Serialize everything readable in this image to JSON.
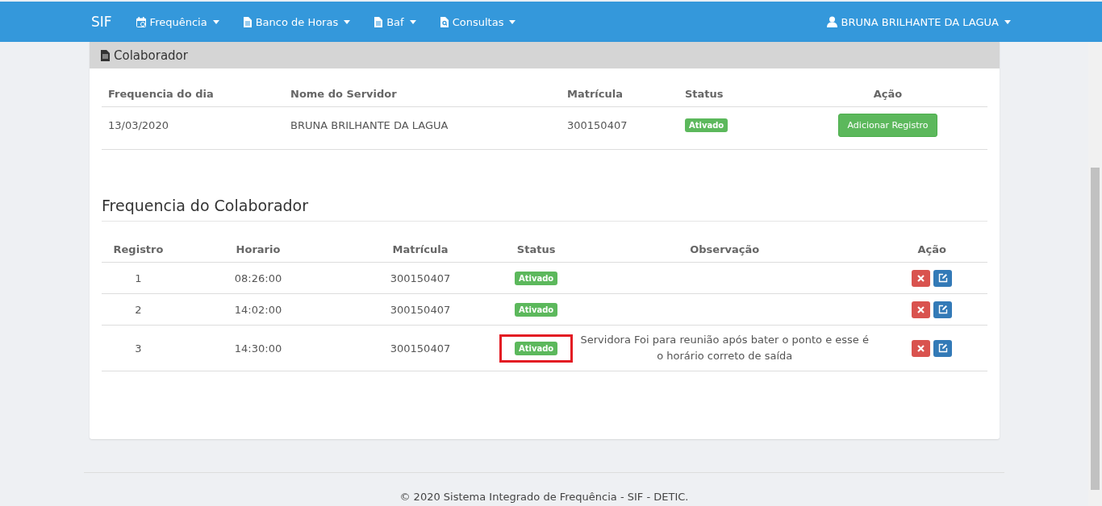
{
  "navbar": {
    "brand": "SIF",
    "menus": [
      {
        "label": "Frequência",
        "kind": "calendar"
      },
      {
        "label": "Banco de Horas",
        "kind": "document"
      },
      {
        "label": "Baf",
        "kind": "document"
      },
      {
        "label": "Consultas",
        "kind": "lookup"
      }
    ],
    "user": "BRUNA BRILHANTE DA LAGUA"
  },
  "panel": {
    "title": "Colaborador",
    "columns": [
      "Frequencia do dia",
      "Nome do Servidor",
      "Matrícula",
      "Status",
      "Ação"
    ],
    "row": {
      "date": "13/03/2020",
      "name": "BRUNA BRILHANTE DA LAGUA",
      "matricula": "300150407",
      "status": "Ativado",
      "action": "Adicionar Registro"
    }
  },
  "frequency": {
    "title": "Frequencia do Colaborador",
    "columns": [
      "Registro",
      "Horario",
      "Matrícula",
      "Status",
      "Observação",
      "Ação"
    ],
    "rows": [
      {
        "registro": "1",
        "horario": "08:26:00",
        "matricula": "300150407",
        "status": "Ativado",
        "highlighted": false
      },
      {
        "registro": "2",
        "horario": "14:02:00",
        "matricula": "300150407",
        "status": "Ativado",
        "highlighted": false
      },
      {
        "registro": "3",
        "horario": "14:30:00",
        "matricula": "300150407",
        "status": "Ativado",
        "observacao": "Servidora Foi para reunião após bater o ponto e esse é o horário correto de saída",
        "highlighted": true
      }
    ]
  },
  "footer": "© 2020 Sistema Integrado de Frequência - SIF - DETIC."
}
